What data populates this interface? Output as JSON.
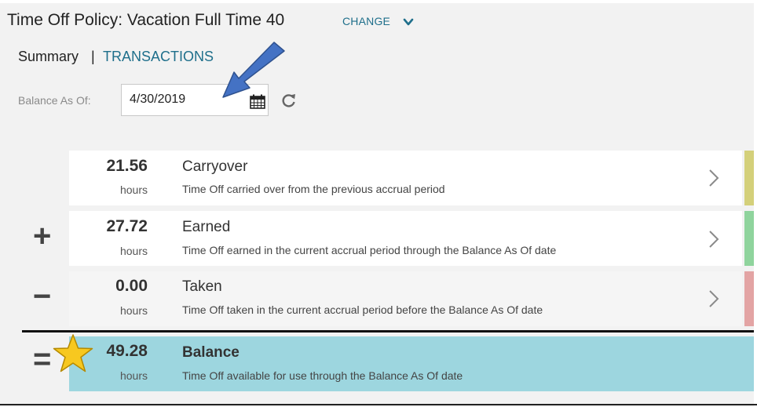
{
  "header": {
    "title": "Time Off Policy: Vacation Full Time 40",
    "change_label": "CHANGE",
    "change_icon": "chevron-down-icon"
  },
  "tabs": {
    "summary": "Summary",
    "divider": "|",
    "transactions": "TRANSACTIONS"
  },
  "balance_as_of": {
    "label": "Balance As Of:",
    "value": "4/30/2019",
    "calendar_icon": "calendar-icon",
    "refresh_icon": "refresh-icon"
  },
  "rows": [
    {
      "value": "21.56",
      "unit": "hours",
      "name": "Carryover",
      "description": "Time Off carried over from the previous accrual period",
      "operator": "",
      "accent": "#d4d07a",
      "icon": "chevron-right-icon"
    },
    {
      "value": "27.72",
      "unit": "hours",
      "name": "Earned",
      "description": "Time Off earned in the current accrual period through the Balance As Of date",
      "operator": "+",
      "accent": "#8fd49d",
      "icon": "chevron-right-icon"
    },
    {
      "value": "0.00",
      "unit": "hours",
      "name": "Taken",
      "description": "Time Off taken in the current accrual period before the Balance As Of date",
      "operator": "−",
      "accent": "#e3a4a4",
      "icon": "chevron-right-icon"
    }
  ],
  "balance": {
    "operator": "=",
    "value": "49.28",
    "unit": "hours",
    "name": "Balance",
    "description": "Time Off available for use through the Balance As Of date",
    "color": "#9dd6df"
  },
  "annotations": {
    "arrow_icon": "blue-arrow-icon",
    "star_icon": "star-icon"
  }
}
